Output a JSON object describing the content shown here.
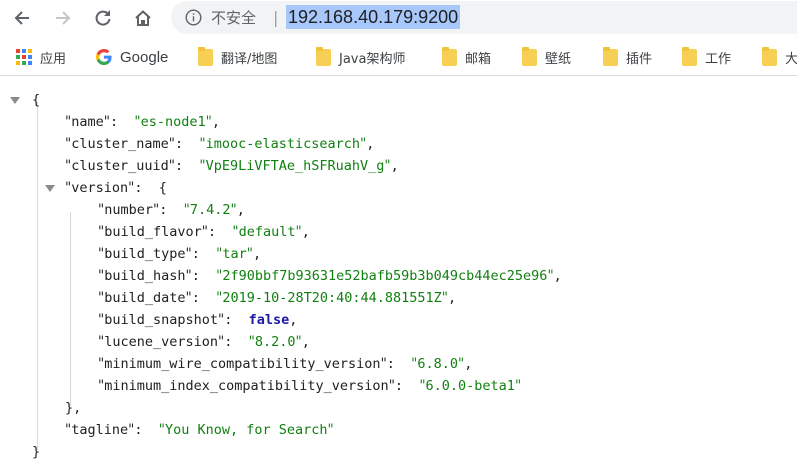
{
  "toolbar": {
    "security_label": "不安全",
    "separator": "|",
    "url": "192.168.40.179:9200"
  },
  "bookmarks": [
    {
      "label": "应用",
      "icon": "apps-grid-icon"
    },
    {
      "label": "Google",
      "icon": "google-icon"
    },
    {
      "label": "翻译/地图",
      "icon": "folder-icon"
    },
    {
      "label": "Java架构师",
      "icon": "folder-icon"
    },
    {
      "label": "邮箱",
      "icon": "folder-icon"
    },
    {
      "label": "壁纸",
      "icon": "folder-icon"
    },
    {
      "label": "插件",
      "icon": "folder-icon"
    },
    {
      "label": "工作",
      "icon": "folder-icon"
    },
    {
      "label": "大",
      "icon": "folder-icon"
    }
  ],
  "json": {
    "open_brace": "{",
    "close_brace": "}",
    "name_key": "name",
    "name_val": "es-node1",
    "cluster_name_key": "cluster_name",
    "cluster_name_val": "imooc-elasticsearch",
    "cluster_uuid_key": "cluster_uuid",
    "cluster_uuid_val": "VpE9LiVFTAe_hSFRuahV_g",
    "version_key": "version",
    "version_open": "{",
    "version_close": "},",
    "number_key": "number",
    "number_val": "7.4.2",
    "build_flavor_key": "build_flavor",
    "build_flavor_val": "default",
    "build_type_key": "build_type",
    "build_type_val": "tar",
    "build_hash_key": "build_hash",
    "build_hash_val": "2f90bbf7b93631e52bafb59b3b049cb44ec25e96",
    "build_date_key": "build_date",
    "build_date_val": "2019-10-28T20:40:44.881551Z",
    "build_snapshot_key": "build_snapshot",
    "build_snapshot_val": "false",
    "lucene_version_key": "lucene_version",
    "lucene_version_val": "8.2.0",
    "min_wire_key": "minimum_wire_compatibility_version",
    "min_wire_val": "6.8.0",
    "min_index_key": "minimum_index_compatibility_version",
    "min_index_val": "6.0.0-beta1",
    "tagline_key": "tagline",
    "tagline_val": "You Know, for Search"
  },
  "colors": {
    "string": "#118011",
    "boolean": "#1a1aa6",
    "url_highlight": "#a8c7fa",
    "folder": "#f7cf55"
  }
}
